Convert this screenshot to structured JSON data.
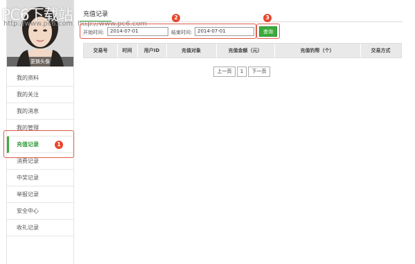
{
  "watermark": {
    "title": "PC6下载站",
    "url": "http://www.pc6.com"
  },
  "sidebar": {
    "avatar_caption": "更换头像",
    "items": [
      {
        "label": "我的资料"
      },
      {
        "label": "我的关注"
      },
      {
        "label": "我的消息"
      },
      {
        "label": "我的管理"
      },
      {
        "label": "充值记录",
        "active": true
      },
      {
        "label": "消费记录"
      },
      {
        "label": "中奖记录"
      },
      {
        "label": "举报记录"
      },
      {
        "label": "安全中心"
      },
      {
        "label": "收礼记录"
      }
    ]
  },
  "tabs": {
    "active": "充值记录"
  },
  "filter": {
    "start_label": "开始时间:",
    "start_value": "2014-07-01",
    "end_label": "结束时间:",
    "end_value": "2014-07-01",
    "query_label": "查询"
  },
  "markers": {
    "m1": "1",
    "m2": "2",
    "m3": "3"
  },
  "table": {
    "columns": [
      "交易号",
      "时间",
      "用户ID",
      "充值对象",
      "充值金额（元）",
      "充值钓帮（个）",
      "交易方式"
    ]
  },
  "pagination": {
    "prev": "上一页",
    "page": "1",
    "next": "下一页"
  },
  "colors": {
    "accent": "#3cab3c",
    "marker": "#e8462d",
    "header_bg": "#e9e9e9"
  }
}
